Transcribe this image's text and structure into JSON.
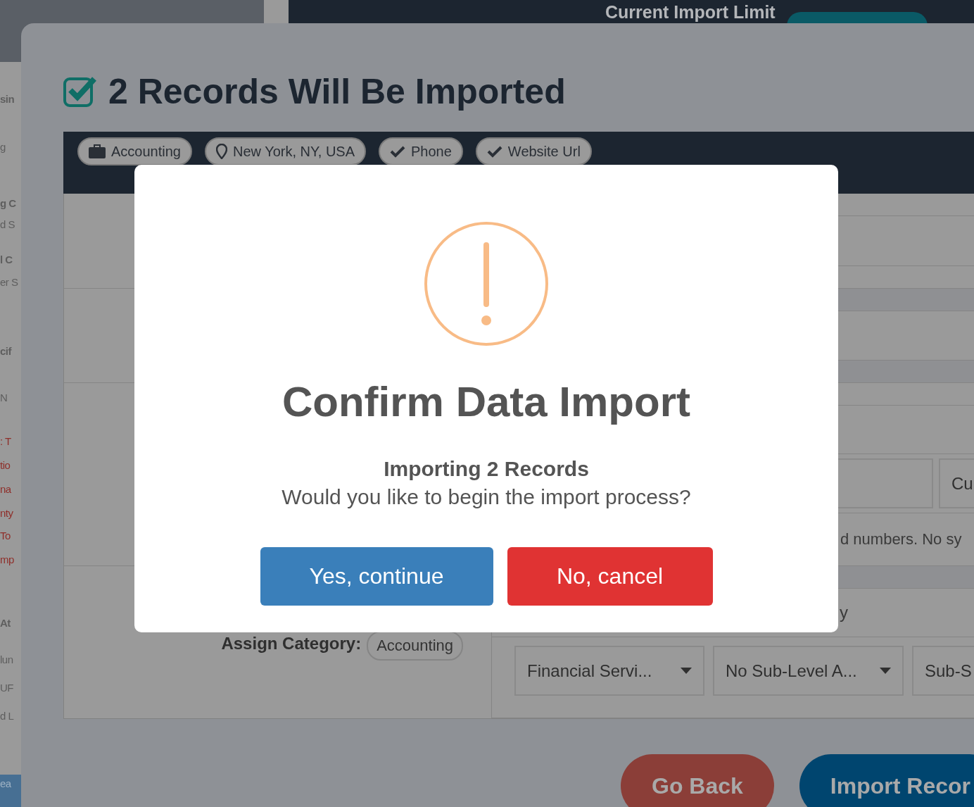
{
  "background_page": {
    "import_limit_label": "Current Import Limit",
    "sidebar_fragments": [
      {
        "text": "sin",
        "kind": "heading"
      },
      {
        "text": "g",
        "kind": "text"
      },
      {
        "text": "g C",
        "kind": "heading"
      },
      {
        "text": "d S",
        "kind": "text"
      },
      {
        "text": "l C",
        "kind": "heading"
      },
      {
        "text": "er S",
        "kind": "text"
      },
      {
        "text": "cif",
        "kind": "heading"
      },
      {
        "text": "N",
        "kind": "text"
      },
      {
        "text": ": T",
        "kind": "warning"
      },
      {
        "text": "tio",
        "kind": "warning"
      },
      {
        "text": "na",
        "kind": "warning"
      },
      {
        "text": "nty",
        "kind": "warning"
      },
      {
        "text": "To",
        "kind": "warning"
      },
      {
        "text": "mp",
        "kind": "warning"
      },
      {
        "text": "At",
        "kind": "heading"
      },
      {
        "text": "lun",
        "kind": "text"
      },
      {
        "text": "UF",
        "kind": "text"
      },
      {
        "text": "d L",
        "kind": "text"
      },
      {
        "text": "ea",
        "kind": "button"
      }
    ]
  },
  "import_modal": {
    "title": "2 Records Will Be Imported",
    "tags": [
      {
        "label": "Accounting",
        "kind": "category"
      },
      {
        "label": "New York, NY, USA",
        "kind": "location"
      },
      {
        "label": "Phone",
        "kind": "field"
      },
      {
        "label": "Website Url",
        "kind": "field"
      }
    ],
    "field_value": "Cu",
    "hint": "d numbers. No sy",
    "row_fragment": "y",
    "assign_category_label": "Assign Category:",
    "assign_category_value": "Accounting",
    "dropdowns": [
      "Financial Servi...",
      "No Sub-Level A...",
      "Sub-S"
    ],
    "buttons": [
      {
        "label": "Go Back",
        "kind": "secondary"
      },
      {
        "label": "Import Recor",
        "kind": "primary"
      }
    ]
  },
  "confirm_dialog": {
    "title": "Confirm Data Import",
    "heading": "Importing 2 Records",
    "message": "Would you like to begin the import process?",
    "buttons": [
      {
        "label": "Yes, continue",
        "kind": "confirm"
      },
      {
        "label": "No, cancel",
        "kind": "cancel"
      }
    ]
  }
}
